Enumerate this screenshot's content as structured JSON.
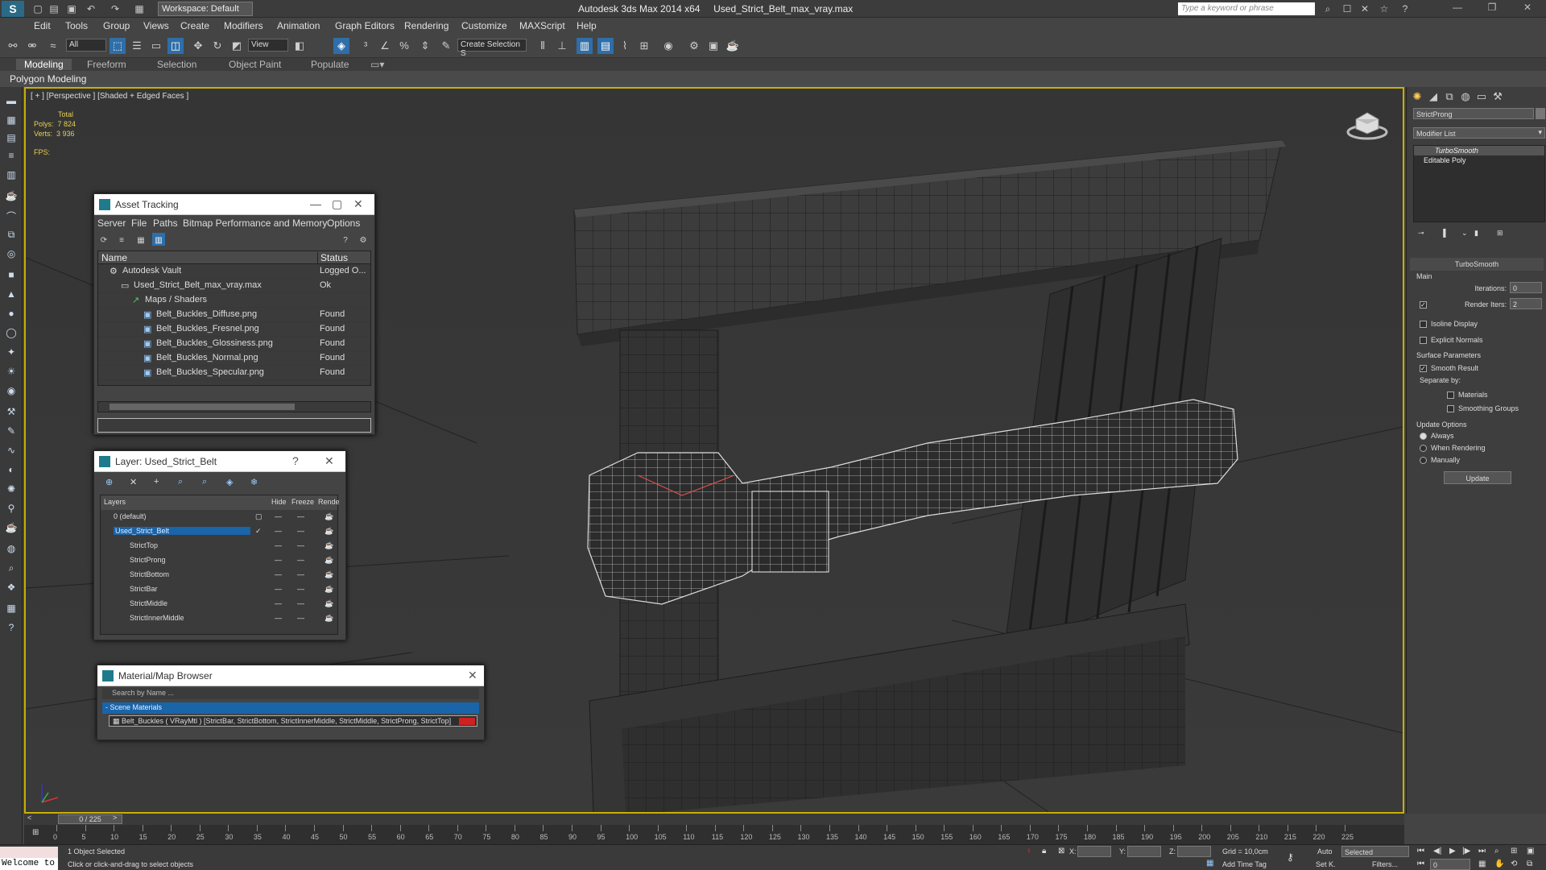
{
  "titlebar": {
    "workspace": "Workspace: Default",
    "app_name": "Autodesk 3ds Max  2014 x64",
    "file_name": "Used_Strict_Belt_max_vray.max",
    "search_placeholder": "Type a keyword or phrase"
  },
  "menu": [
    "Edit",
    "Tools",
    "Group",
    "Views",
    "Create",
    "Modifiers",
    "Animation",
    "Graph Editors",
    "Rendering",
    "Customize",
    "MAXScript",
    "Help"
  ],
  "toolbar": {
    "filter_dropdown": "All",
    "view_dropdown": "View",
    "selection_set": "Create Selection S"
  },
  "ribbon": {
    "tabs": [
      "Modeling",
      "Freeform",
      "Selection",
      "Object Paint",
      "Populate"
    ],
    "active_tab": "Modeling",
    "subpanel": "Polygon Modeling"
  },
  "viewport": {
    "label": "[ + ] [Perspective ] [Shaded + Edged Faces ]",
    "stats_total": "Total",
    "polys_label": "Polys:",
    "polys_value": "7 824",
    "verts_label": "Verts:",
    "verts_value": "3 936",
    "fps_label": "FPS:"
  },
  "asset_tracking": {
    "title": "Asset Tracking",
    "menu": [
      "Server",
      "File",
      "Paths",
      "Bitmap Performance and Memory",
      "Options"
    ],
    "columns": [
      "Name",
      "Status"
    ],
    "rows": [
      {
        "name": "Autodesk Vault",
        "status": "Logged O..."
      },
      {
        "name": "Used_Strict_Belt_max_vray.max",
        "status": "Ok"
      },
      {
        "name": "Maps / Shaders",
        "status": ""
      },
      {
        "name": "Belt_Buckles_Diffuse.png",
        "status": "Found"
      },
      {
        "name": "Belt_Buckles_Fresnel.png",
        "status": "Found"
      },
      {
        "name": "Belt_Buckles_Glossiness.png",
        "status": "Found"
      },
      {
        "name": "Belt_Buckles_Normal.png",
        "status": "Found"
      },
      {
        "name": "Belt_Buckles_Specular.png",
        "status": "Found"
      }
    ]
  },
  "layer_panel": {
    "title": "Layer: Used_Strict_Belt",
    "columns": [
      "Layers",
      "Hide",
      "Freeze",
      "Rende"
    ],
    "rows": [
      {
        "name": "0 (default)"
      },
      {
        "name": "Used_Strict_Belt"
      },
      {
        "name": "StrictTop"
      },
      {
        "name": "StrictProng"
      },
      {
        "name": "StrictBottom"
      },
      {
        "name": "StrictBar"
      },
      {
        "name": "StrictMiddle"
      },
      {
        "name": "StrictInnerMiddle"
      }
    ]
  },
  "material_browser": {
    "title": "Material/Map Browser",
    "search_placeholder": "Search by Name ...",
    "group": "- Scene Materials",
    "item": "Belt_Buckles  ( VRayMtl )  [StrictBar, StrictBottom, StrictInnerMiddle, StrictMiddle, StrictProng, StrictTop]"
  },
  "command_panel": {
    "object_name": "StrictProng",
    "modifier_list": "Modifier List",
    "stack": [
      "TurboSmooth",
      "Editable Poly"
    ],
    "rollout_title": "TurboSmooth",
    "main_label": "Main",
    "iterations_label": "Iterations:",
    "iterations_value": "0",
    "render_iters_label": "Render Iters:",
    "render_iters_value": "2",
    "isoline": "Isoline Display",
    "explicit_normals": "Explicit Normals",
    "surface_params": "Surface Parameters",
    "smooth_result": "Smooth Result",
    "separate_by": "Separate by:",
    "materials": "Materials",
    "smoothing_groups": "Smoothing Groups",
    "update_options": "Update Options",
    "always": "Always",
    "when_rendering": "When Rendering",
    "manually": "Manually",
    "update_button": "Update"
  },
  "timeline": {
    "frame_counter": "0 / 225",
    "ticks": [
      "0",
      "5",
      "10",
      "15",
      "20",
      "25",
      "30",
      "35",
      "40",
      "45",
      "50",
      "55",
      "60",
      "65",
      "70",
      "75",
      "80",
      "85",
      "90",
      "95",
      "100",
      "105",
      "110",
      "115",
      "120",
      "125",
      "130",
      "135",
      "140",
      "145",
      "150",
      "155",
      "160",
      "165",
      "170",
      "175",
      "180",
      "185",
      "190",
      "195",
      "200",
      "205",
      "210",
      "215",
      "220",
      "225"
    ]
  },
  "statusbar": {
    "welcome": "Welcome to",
    "selected_count": "1 Object Selected",
    "hint": "Click or click-and-drag to select objects",
    "x_label": "X:",
    "y_label": "Y:",
    "z_label": "Z:",
    "grid": "Grid = 10,0cm",
    "add_time_tag": "Add Time Tag",
    "auto": "Auto",
    "set_k": "Set K.",
    "selected_dd": "Selected",
    "filters": "Filters...",
    "frame": "0"
  }
}
